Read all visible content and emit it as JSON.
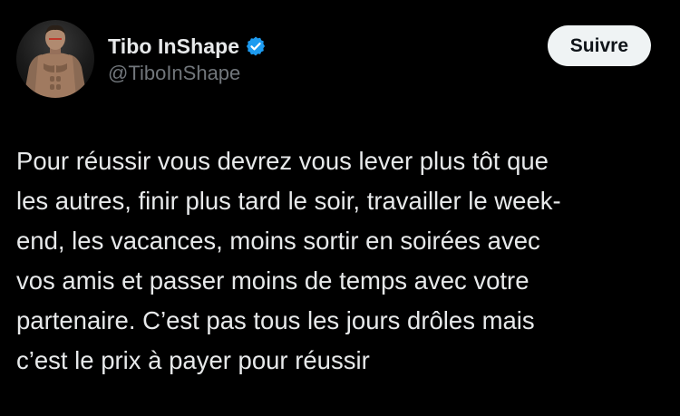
{
  "author": {
    "display_name": "Tibo InShape",
    "handle": "@TiboInShape",
    "verified": true,
    "avatar_icon": "profile-photo"
  },
  "follow_button": {
    "label": "Suivre"
  },
  "tweet": {
    "text": "Pour réussir vous devrez vous lever plus tôt que\nles autres, finir plus tard le soir, travailler le week-\nend, les vacances, moins sortir en soirées avec\nvos amis et passer moins de temps avec votre\npartenaire. C’est pas tous les jours drôles mais\nc’est le prix à payer pour réussir"
  },
  "colors": {
    "background": "#000000",
    "primary_text": "#e7e9ea",
    "secondary_text": "#71767b",
    "verified_badge": "#1d9bf0",
    "button_background": "#eff3f4",
    "button_text": "#0f1419"
  }
}
